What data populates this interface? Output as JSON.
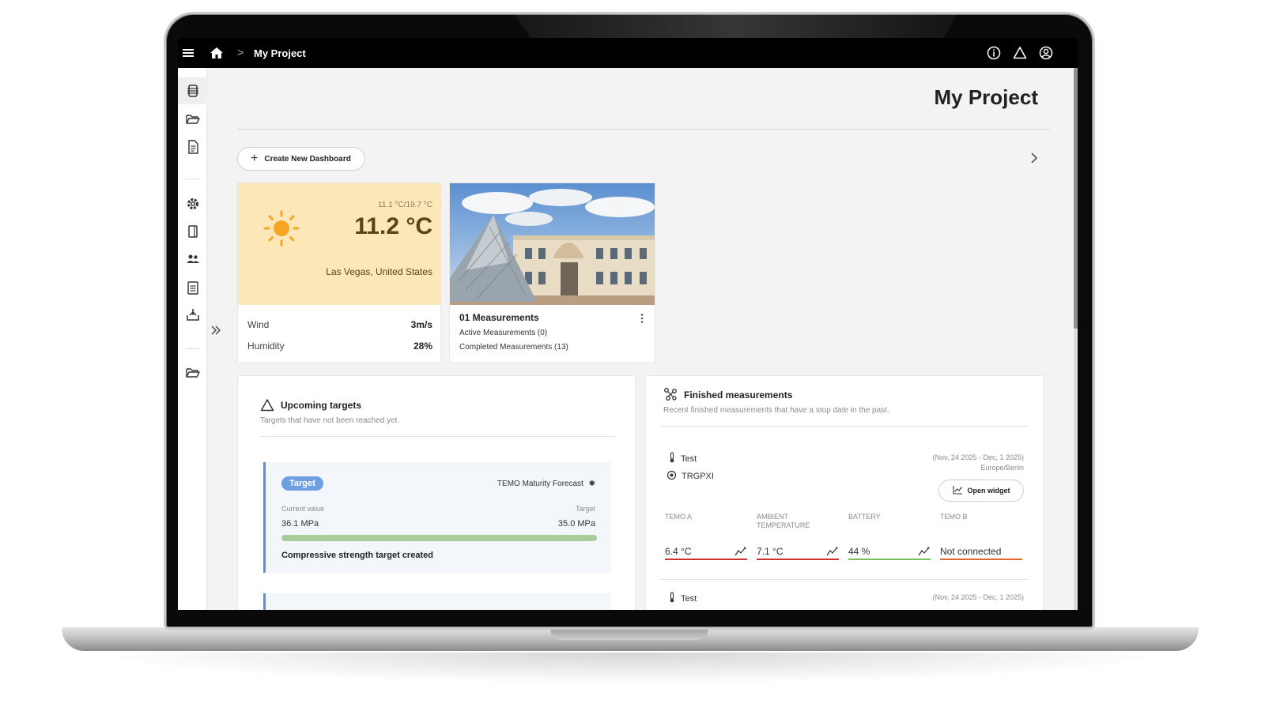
{
  "topbar": {
    "title": "My Project",
    "breadcrumb_sep": ">"
  },
  "page": {
    "title": "My Project",
    "create_dashboard_label": "Create New Dashboard"
  },
  "weather": {
    "range": "11.1 °C/19.7 °C",
    "temperature": "11.2 °C",
    "location": "Las Vegas, United States",
    "wind_label": "Wind",
    "wind_value": "3m/s",
    "humidity_label": "Humidity",
    "humidity_value": "28%",
    "colors": {
      "panel": "#fbe7b8",
      "sun": "#f5a623"
    }
  },
  "measurement_card": {
    "title": "01 Measurements",
    "active": "Active Measurements (0)",
    "completed": "Completed Measurements (13)"
  },
  "upcoming": {
    "title": "Upcoming targets",
    "subtitle": "Targets that have not been reached yet.",
    "card": {
      "badge": "Target",
      "forecast": "TEMO Maturity Forecast",
      "current_label": "Current value",
      "current_value": "36.1 MPa",
      "target_label": "Target",
      "target_value": "35.0 MPa",
      "progress": 1.0,
      "message": "Compressive strength target created"
    }
  },
  "finished": {
    "title": "Finished measurements",
    "subtitle": "Recent finished measurements that have a stop date in the past.",
    "item": {
      "name": "Test",
      "sensor_id": "TRGPXI",
      "date_range": "(Nov, 24 2025 - Dec, 1 2025)",
      "timezone": "Europe/Berlin",
      "open_widget_label": "Open widget",
      "sensors": [
        {
          "name": "TEMO A",
          "value": "6.4 °C",
          "status": "alert"
        },
        {
          "name": "AMBIENT TEMPERATURE",
          "value": "7.1 °C",
          "status": "alert"
        },
        {
          "name": "BATTERY",
          "value": "44 %",
          "status": "ok"
        },
        {
          "name": "TEMO B",
          "value": "Not connected",
          "status": "off"
        }
      ]
    },
    "next_item": {
      "name": "Test",
      "date_range": "(Nov, 24 2025 - Dec, 1 2025)"
    }
  }
}
